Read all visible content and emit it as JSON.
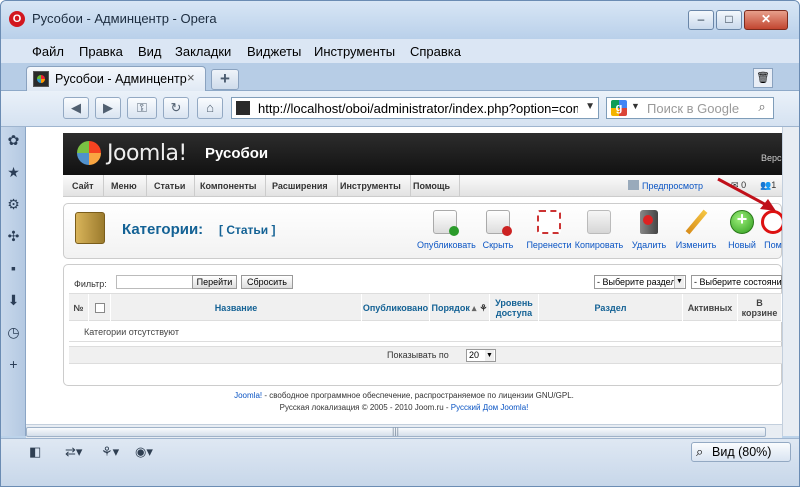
{
  "window": {
    "title": "Русобои - Админцентр - Opera",
    "min": "–",
    "max": "□",
    "close": "✕"
  },
  "menu": [
    "Файл",
    "Правка",
    "Вид",
    "Закладки",
    "Виджеты",
    "Инструменты",
    "Справка"
  ],
  "tab": {
    "label": "Русобои - Админцентр",
    "close": "×",
    "new": "+"
  },
  "nav": {
    "back": "◀",
    "forward": "▶",
    "key": "⚿",
    "reload": "↻",
    "home": "⌂",
    "url": "http://localhost/oboi/administrator/index.php?option=com_c",
    "search_placeholder": "Поиск в Google",
    "search_engine": "g"
  },
  "joomla": {
    "logo_text": "Joomla!",
    "site_name": "Русобои",
    "version": "Верси",
    "menu": [
      "Сайт",
      "Меню",
      "Статьи",
      "Компоненты",
      "Расширения",
      "Инструменты",
      "Помощь"
    ],
    "preview": "Предпросмотр",
    "msg_count": "0",
    "user_count": "1",
    "logout_icon": "✕"
  },
  "toolbar": {
    "title": "Категории:",
    "subtitle": "[ Статьи ]",
    "buttons": [
      "Опубликовать",
      "Скрыть",
      "Перенести",
      "Копировать",
      "Удалить",
      "Изменить",
      "Новый",
      "Пом"
    ]
  },
  "filter": {
    "label": "Фильтр:",
    "go": "Перейти",
    "reset": "Сбросить",
    "section_select": "- Выберите раздел -",
    "state_select": "- Выберите состояние -"
  },
  "table": {
    "headers": [
      "№",
      "",
      "Название",
      "Опубликовано",
      "Порядок",
      "Уровень доступа",
      "Раздел",
      "Активных",
      "В корзине"
    ],
    "empty": "Категории отсутствуют"
  },
  "pager": {
    "label": "Показывать по",
    "value": "20"
  },
  "footer": {
    "line1_link": "Joomla!",
    "line1_text": " - свободное программное обеспечение, распространяемое по лицензии GNU/GPL.",
    "line2_text": "Русская локализация © 2005 - 2010 Joom.ru - ",
    "line2_link": "Русский Дом Joomla!"
  },
  "status": {
    "zoom": "Вид (80%)"
  },
  "colors": {
    "joomla_blue": "#146295",
    "link_blue": "#0b55c4",
    "header_dark": "#1a1a1a",
    "arrow_red": "#c0101a"
  }
}
